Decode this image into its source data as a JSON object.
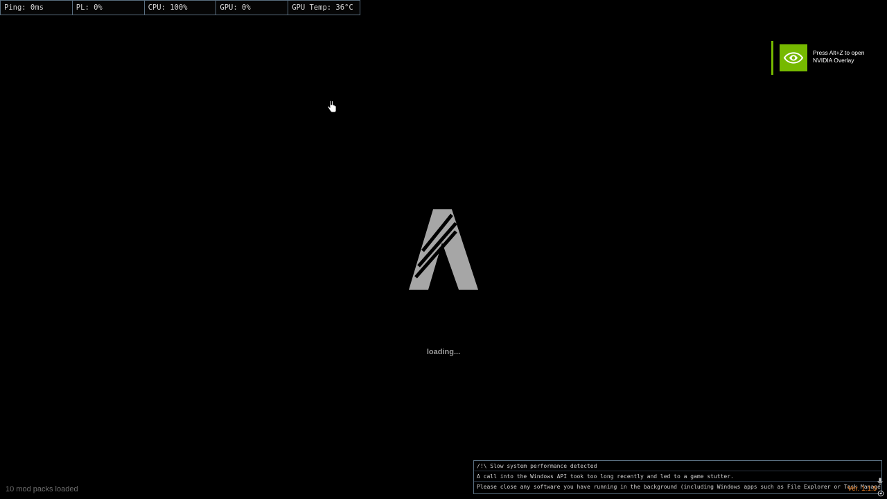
{
  "stats": {
    "ping": "Ping: 0ms",
    "pl": "PL: 0%",
    "cpu": "CPU: 100%",
    "gpu": "GPU: 0%",
    "gpu_temp": "GPU Temp: 36°C"
  },
  "nvidia": {
    "line1": "Press Alt+Z to open",
    "line2": "NVIDIA Overlay",
    "accent": "#76b900"
  },
  "loading": {
    "text": "loading..."
  },
  "footer": {
    "mod_packs": "10 mod packs loaded",
    "version": "Ver. 1.1.5"
  },
  "warning": {
    "title": "/!\\ Slow system performance detected",
    "line1": "A call into the Windows API took too long recently and led to a game stutter.",
    "line2": "Please close any software you have running in the background (including Windows apps such as File Explorer or Task Manager)."
  },
  "icons": {
    "logo": "fivem-logo-icon",
    "cursor": "hand-cursor-icon",
    "nvidia": "nvidia-eye-icon",
    "mic": "microphone-icon",
    "cam": "camera-icon"
  }
}
